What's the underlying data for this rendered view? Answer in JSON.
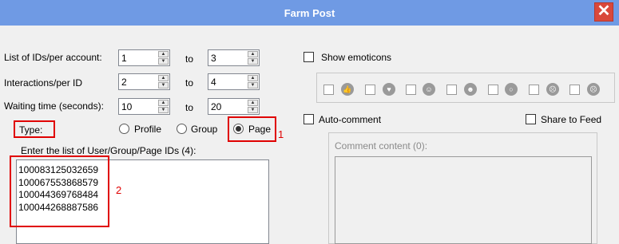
{
  "window": {
    "title": "Farm Post",
    "close_glyph": "✕"
  },
  "form": {
    "ids_per_account": {
      "label": "List of IDs/per account:",
      "from": "1",
      "to_label": "to",
      "to": "3"
    },
    "interactions_per_id": {
      "label": "Interactions/per ID",
      "from": "2",
      "to_label": "to",
      "to": "4"
    },
    "waiting_time": {
      "label": "Waiting time (seconds):",
      "from": "10",
      "to_label": "to",
      "to": "20"
    },
    "type": {
      "label": "Type:",
      "options": [
        "Profile",
        "Group",
        "Page"
      ],
      "selected": "Page"
    },
    "id_list_label": "Enter the list of User/Group/Page IDs (4):",
    "id_list": [
      "100083125032659",
      "100067553868579",
      "100044369768484",
      "100044268887586"
    ]
  },
  "right": {
    "show_emoticons_label": "Show emoticons",
    "emoticons": [
      "like-icon",
      "heart-icon",
      "hug-icon",
      "haha-icon",
      "wow-icon",
      "sad-icon",
      "angry-icon"
    ],
    "auto_comment_label": "Auto-comment",
    "share_to_feed_label": "Share to Feed",
    "comment_content_label": "Comment content (0):"
  },
  "annotations": {
    "marker_1": "1",
    "marker_2": "2"
  },
  "colors": {
    "titlebar": "#6f9ae4",
    "close": "#d9483b",
    "annotation": "#e00000"
  }
}
